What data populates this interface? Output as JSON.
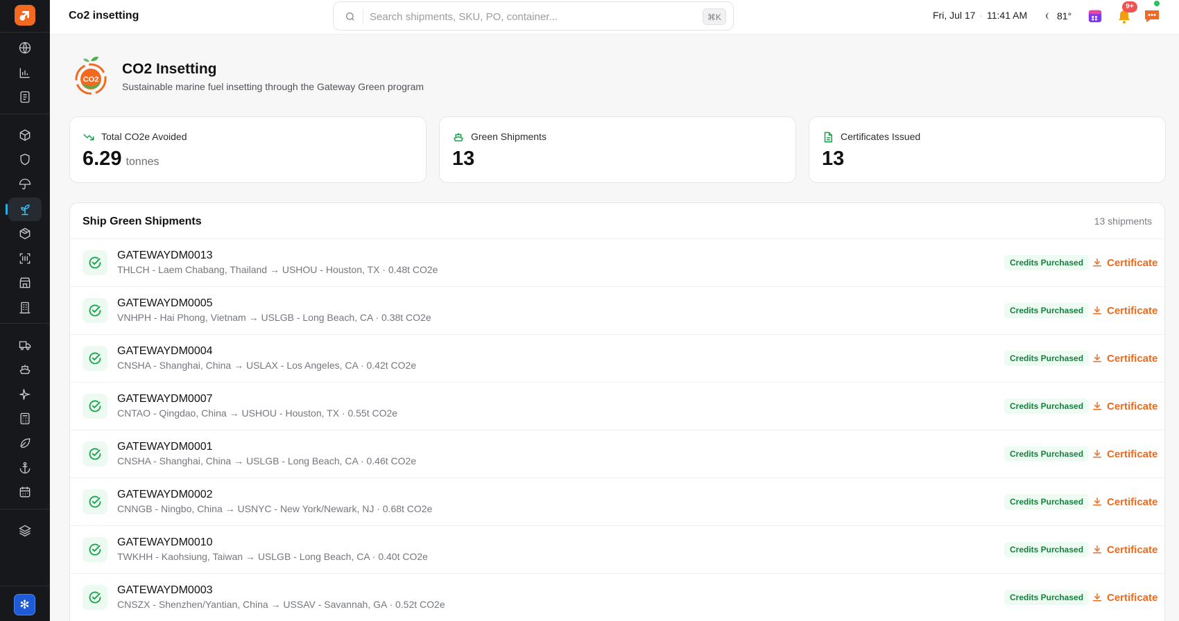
{
  "app": {
    "title": "Co2 insetting"
  },
  "search": {
    "placeholder": "Search shipments, SKU, PO, container...",
    "shortcut": "⌘K"
  },
  "topbar": {
    "date": "Fri, Jul 17",
    "separator": "·",
    "time": "11:41 AM",
    "temperature": "81°",
    "notification_badge": "9+"
  },
  "sidebar": {
    "icons": [
      "globe-icon",
      "bar-chart-icon",
      "document-icon",
      "box-icon",
      "shield-icon",
      "umbrella-icon",
      "sprout-icon",
      "package-icon",
      "scan-icon",
      "store-icon",
      "building-icon",
      "truck-icon",
      "ship-icon",
      "plane-icon",
      "calculator-icon",
      "leaf-icon",
      "anchor-icon",
      "calendar-icon",
      "layers-icon"
    ],
    "active": "sprout-icon"
  },
  "header": {
    "title": "CO2 Insetting",
    "subtitle": "Sustainable marine fuel insetting through the Gateway Green program",
    "logo_text": "CO2"
  },
  "stats": [
    {
      "label": "Total CO2e Avoided",
      "value": "6.29",
      "unit": "tonnes",
      "icon": "trending-down-icon"
    },
    {
      "label": "Green Shipments",
      "value": "13",
      "unit": "",
      "icon": "ship-icon"
    },
    {
      "label": "Certificates Issued",
      "value": "13",
      "unit": "",
      "icon": "file-icon"
    }
  ],
  "shipments": {
    "title": "Ship Green Shipments",
    "count_label": "13 shipments",
    "rows": [
      {
        "id": "GATEWAYDM0013",
        "route": "THLCH - Laem Chabang, Thailand → USHOU - Houston, TX · 0.48t CO2e",
        "status": "Credits Purchased",
        "action": "Certificate"
      },
      {
        "id": "GATEWAYDM0005",
        "route": "VNHPH - Hai Phong, Vietnam → USLGB - Long Beach, CA · 0.38t CO2e",
        "status": "Credits Purchased",
        "action": "Certificate"
      },
      {
        "id": "GATEWAYDM0004",
        "route": "CNSHA - Shanghai, China → USLAX - Los Angeles, CA · 0.42t CO2e",
        "status": "Credits Purchased",
        "action": "Certificate"
      },
      {
        "id": "GATEWAYDM0007",
        "route": "CNTAO - Qingdao, China → USHOU - Houston, TX · 0.55t CO2e",
        "status": "Credits Purchased",
        "action": "Certificate"
      },
      {
        "id": "GATEWAYDM0001",
        "route": "CNSHA - Shanghai, China → USLGB - Long Beach, CA · 0.46t CO2e",
        "status": "Credits Purchased",
        "action": "Certificate"
      },
      {
        "id": "GATEWAYDM0002",
        "route": "CNNGB - Ningbo, China → USNYC - New York/Newark, NJ · 0.68t CO2e",
        "status": "Credits Purchased",
        "action": "Certificate"
      },
      {
        "id": "GATEWAYDM0010",
        "route": "TWKHH - Kaohsiung, Taiwan → USLGB - Long Beach, CA · 0.40t CO2e",
        "status": "Credits Purchased",
        "action": "Certificate"
      },
      {
        "id": "GATEWAYDM0003",
        "route": "CNSZX - Shenzhen/Yantian, China → USSAV - Savannah, GA · 0.52t CO2e",
        "status": "Credits Purchased",
        "action": "Certificate"
      }
    ]
  },
  "colors": {
    "accent": "#ea6a1e",
    "green": "#16a34a",
    "sidebar_bg": "#17181c",
    "ai_button": "#1d5bd8"
  }
}
